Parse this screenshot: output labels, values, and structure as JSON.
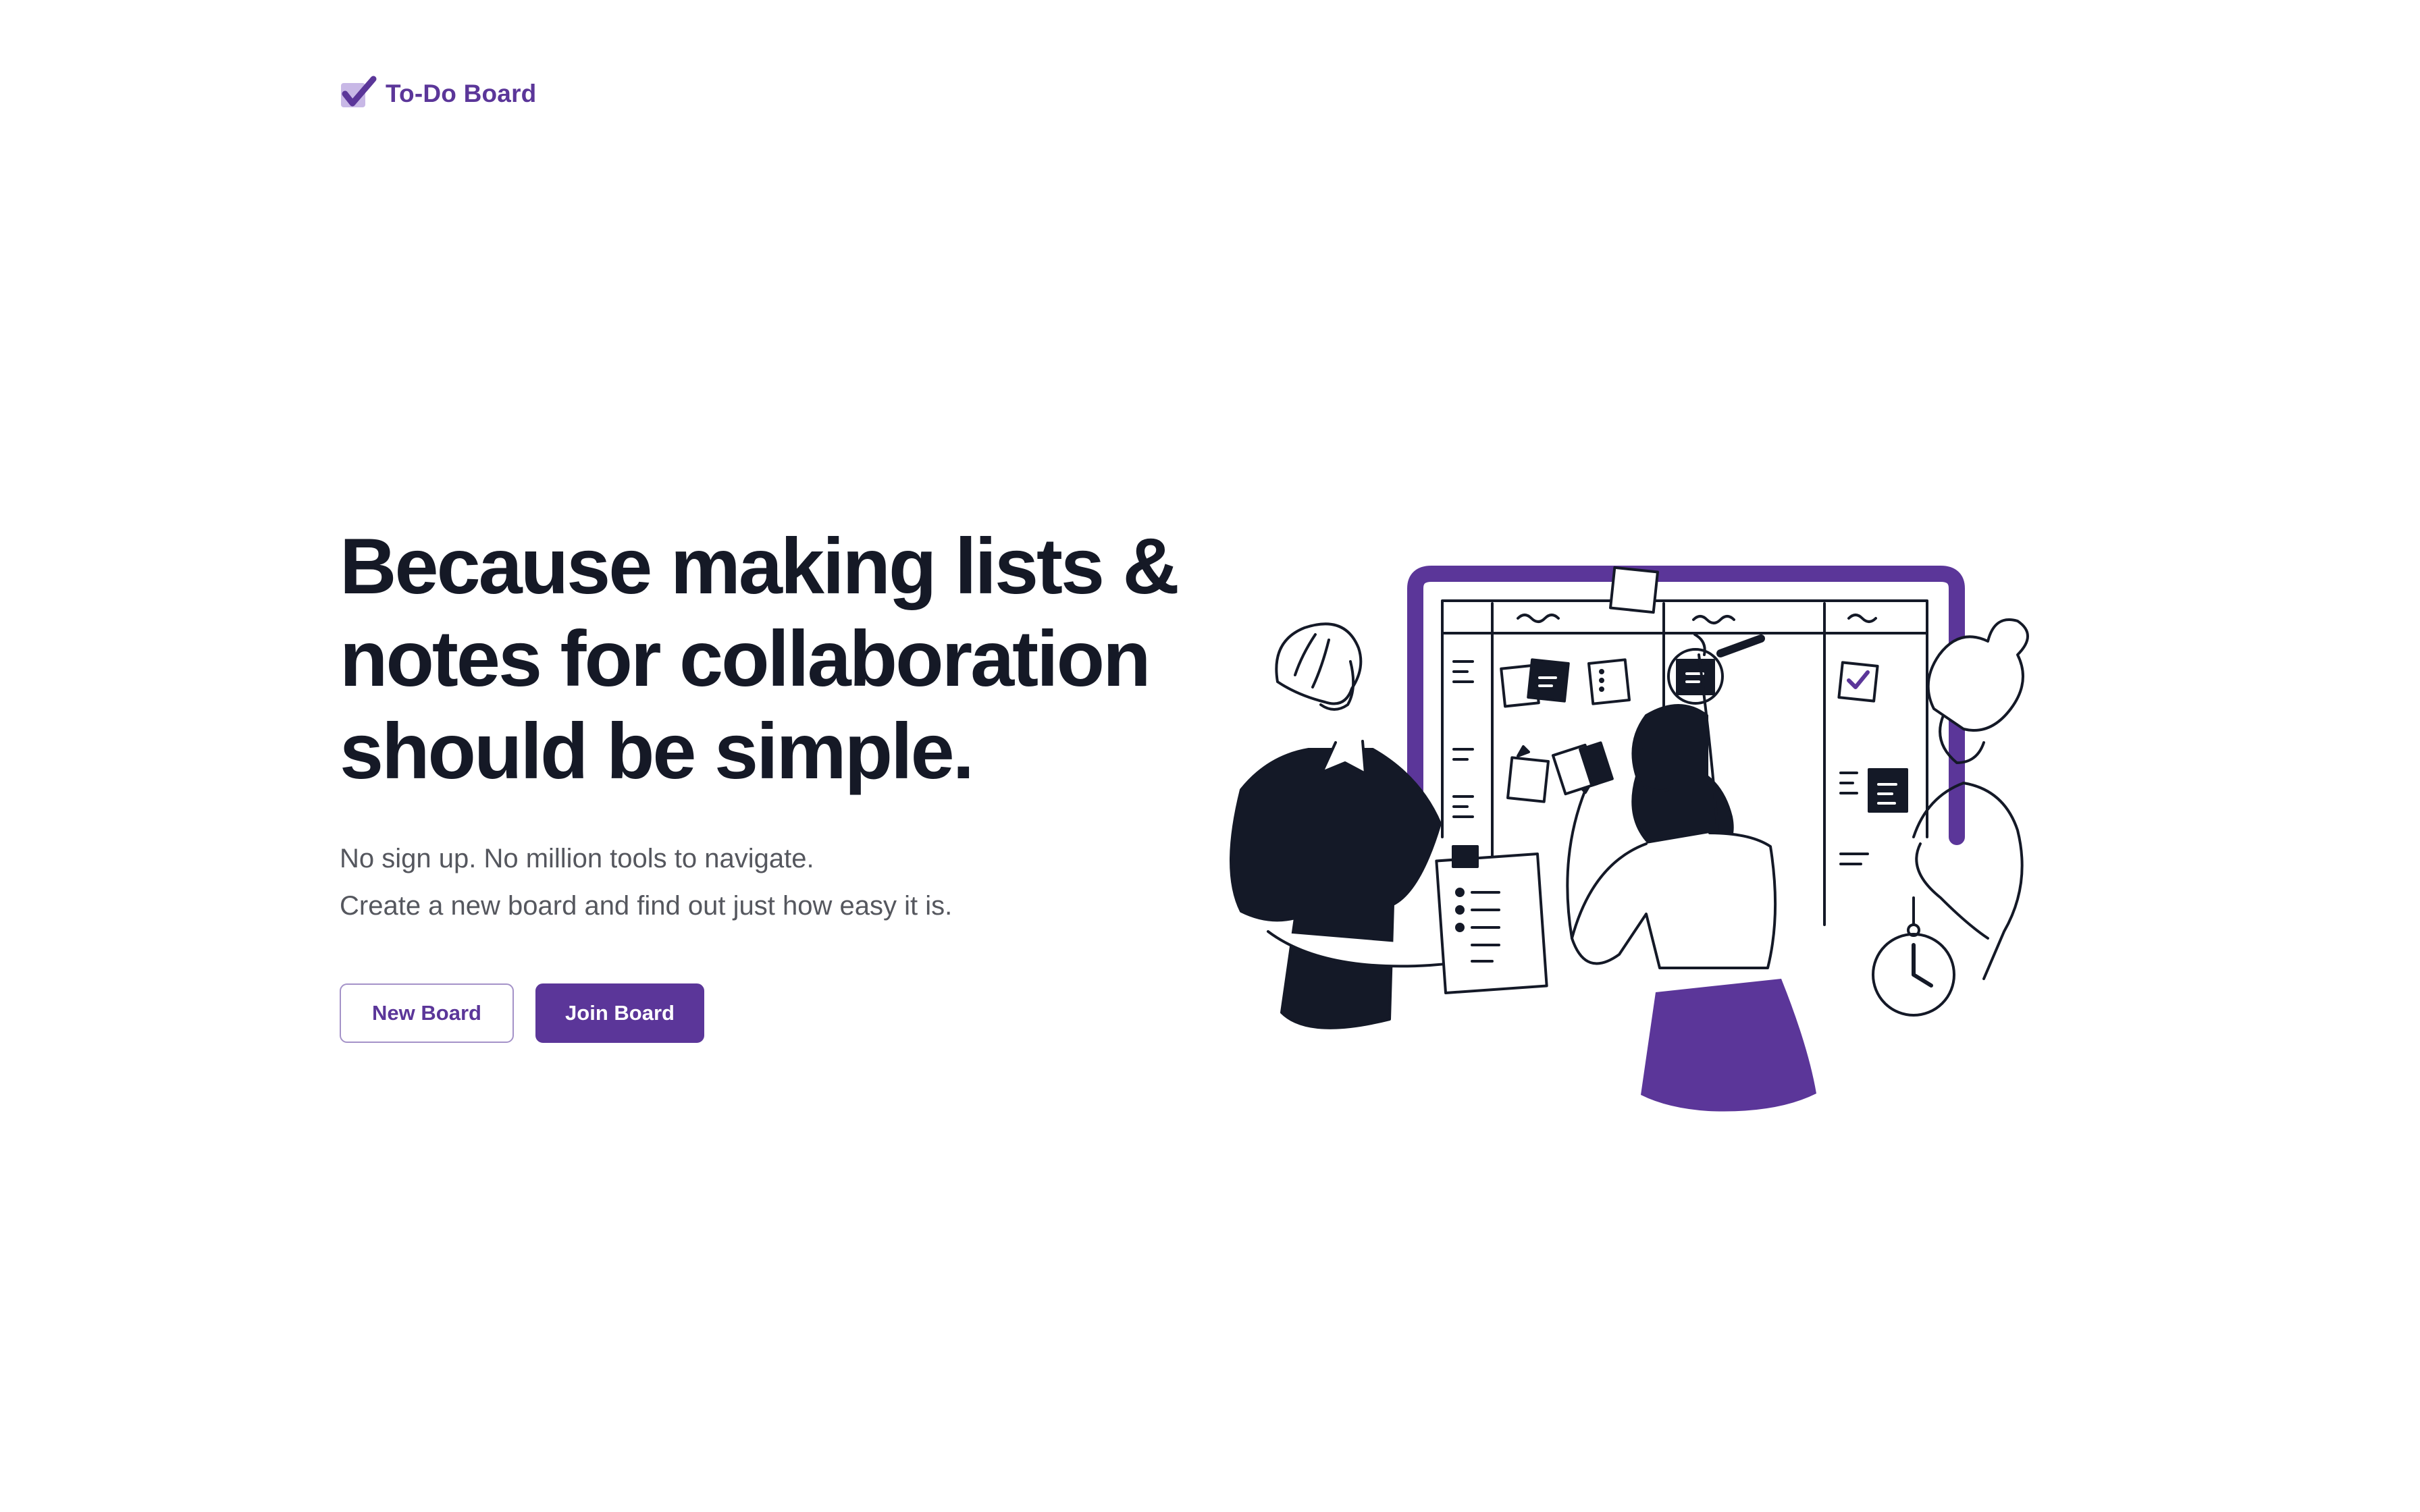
{
  "brand": {
    "name": "To-Do Board",
    "icon": "checkmark-icon",
    "color": "#5b3699"
  },
  "hero": {
    "headline_lines": [
      "Because making lists &",
      "notes for collaboration",
      "should be simple."
    ],
    "subtext_lines": [
      "No sign up. No million tools to navigate.",
      "Create a new board and find out just how easy it is."
    ]
  },
  "actions": {
    "new_board_label": "New Board",
    "join_board_label": "Join Board"
  },
  "illustration": {
    "name": "team-kanban-illustration"
  },
  "colors": {
    "accent": "#5b3699",
    "heading": "#151926",
    "body": "#55575e",
    "ink": "#141927",
    "background": "#ffffff"
  }
}
